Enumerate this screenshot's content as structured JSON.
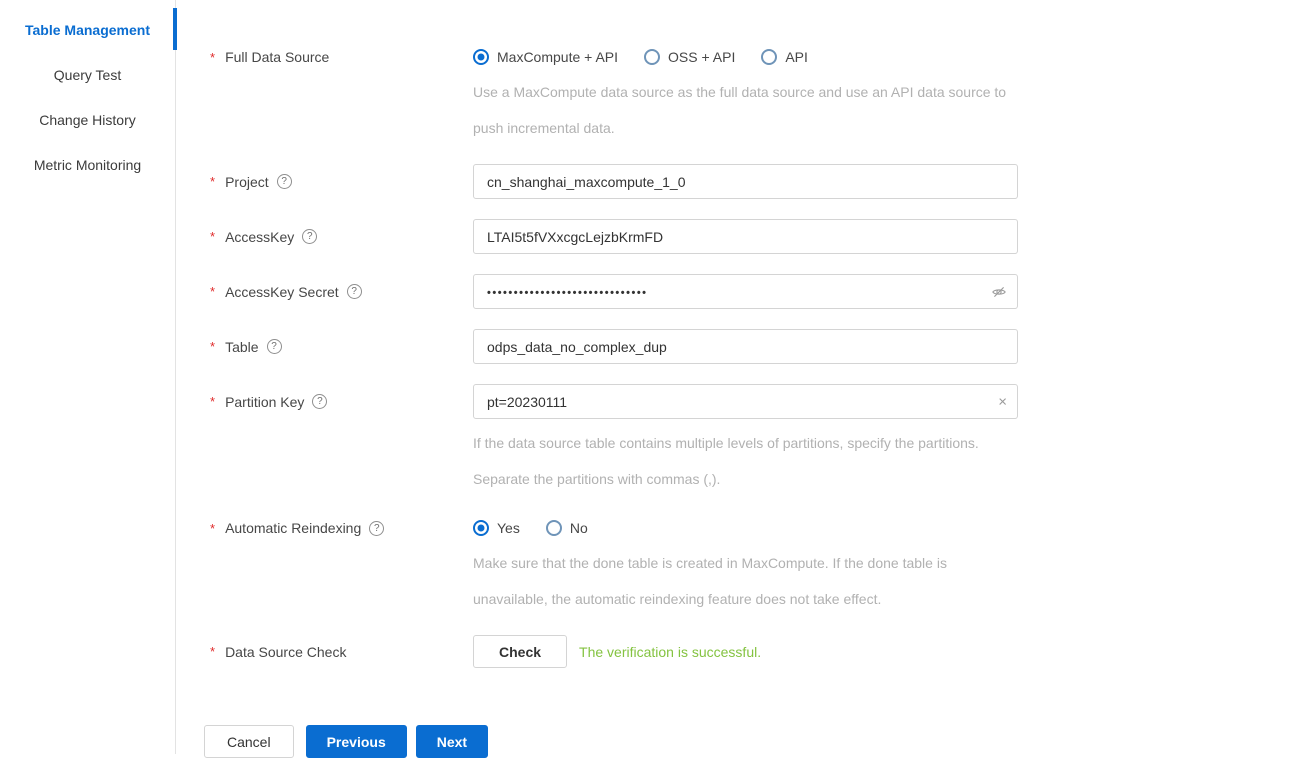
{
  "colors": {
    "accent_blue": "#0a6dd1",
    "success_green": "#84c341",
    "required_red": "#e02b2b"
  },
  "sidebar": {
    "items": [
      {
        "label": "Table Management",
        "active": true
      },
      {
        "label": "Query Test",
        "active": false
      },
      {
        "label": "Change History",
        "active": false
      },
      {
        "label": "Metric Monitoring",
        "active": false
      }
    ]
  },
  "form": {
    "required_marker": "*",
    "help_icon": "?",
    "full_data_source": {
      "label": "Full Data Source",
      "options": [
        "MaxCompute + API",
        "OSS + API",
        "API"
      ],
      "selected": "MaxCompute + API",
      "help": "Use a MaxCompute data source as the full data source and use an API data source to push incremental data."
    },
    "project": {
      "label": "Project",
      "value": "cn_shanghai_maxcompute_1_0"
    },
    "accesskey": {
      "label": "AccessKey",
      "value": "LTAI5t5fVXxcgcLejzbKrmFD"
    },
    "accesskey_secret": {
      "label": "AccessKey Secret",
      "value": "••••••••••••••••••••••••••••••"
    },
    "table": {
      "label": "Table",
      "value": "odps_data_no_complex_dup"
    },
    "partition_key": {
      "label": "Partition Key",
      "value": "pt=20230111",
      "clear_icon": "×",
      "help": "If the data source table contains multiple levels of partitions, specify the partitions. Separate the partitions with commas (,)."
    },
    "automatic_reindexing": {
      "label": "Automatic Reindexing",
      "options": [
        "Yes",
        "No"
      ],
      "selected": "Yes",
      "help": "Make sure that the done table is created in MaxCompute. If the done table is unavailable, the automatic reindexing feature does not take effect."
    },
    "data_source_check": {
      "label": "Data Source Check",
      "button_label": "Check",
      "result": "The verification is successful."
    }
  },
  "footer": {
    "cancel": "Cancel",
    "previous": "Previous",
    "next": "Next"
  }
}
